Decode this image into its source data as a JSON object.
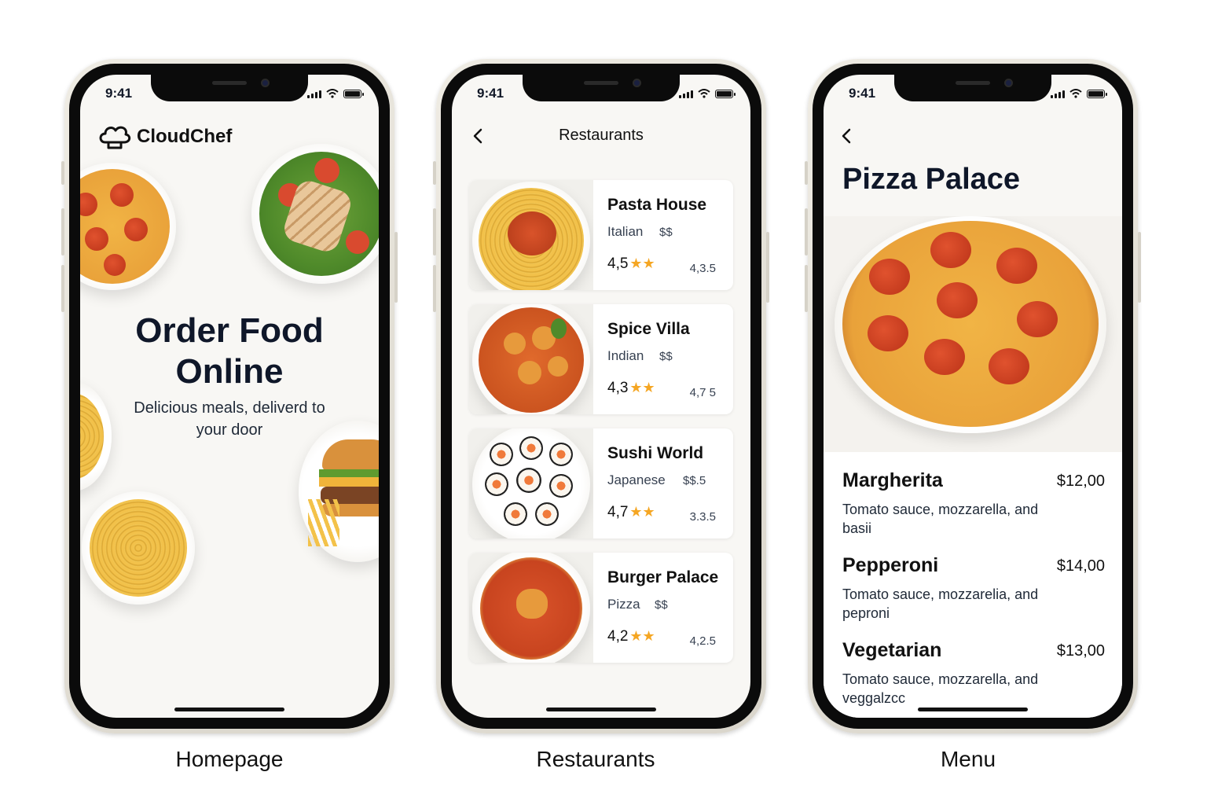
{
  "status_time": "9:41",
  "captions": [
    "Homepage",
    "Restaurants",
    "Menu"
  ],
  "homepage": {
    "brand": "CloudChef",
    "hero_title_line1": "Order Food",
    "hero_title_line2": "Online",
    "hero_subtitle": "Delicious meals, deliverd to your door"
  },
  "restaurants": {
    "title": "Restaurants",
    "items": [
      {
        "name": "Pasta House",
        "cuisine": "Italian",
        "price": "$$",
        "rating": "4,5",
        "stars": "★★",
        "distance": "4,3.5"
      },
      {
        "name": "Spice Villa",
        "cuisine": "Indian",
        "price": "$$",
        "rating": "4,3",
        "stars": "★★",
        "distance": "4,7 5"
      },
      {
        "name": "Sushi World",
        "cuisine": "Japanese",
        "price": "$$.5",
        "rating": "4,7",
        "stars": "★★",
        "distance": "3.3.5"
      },
      {
        "name": "Burger Palace",
        "cuisine": "Pizza",
        "price": "$$",
        "rating": "4,2",
        "stars": "★★",
        "distance": "4,2.5"
      }
    ]
  },
  "menu": {
    "title": "Pizza Palace",
    "items": [
      {
        "name": "Margherita",
        "price": "$12,00",
        "description": "Tomato sauce, mozzarella, and basii"
      },
      {
        "name": "Pepperoni",
        "price": "$14,00",
        "description": "Tomato sauce, mozzarelia, and peproni"
      },
      {
        "name": "Vegetarian",
        "price": "$13,00",
        "description": "Tomato sauce, mozzarella, and veggalzcc"
      }
    ]
  },
  "colors": {
    "star": "#f5a623",
    "screen_bg": "#f8f7f4",
    "text_dark": "#0f1729"
  },
  "icons": [
    "chef-hat-icon",
    "back-chevron-icon",
    "signal-icon",
    "wifi-icon",
    "battery-icon",
    "star-icon"
  ]
}
